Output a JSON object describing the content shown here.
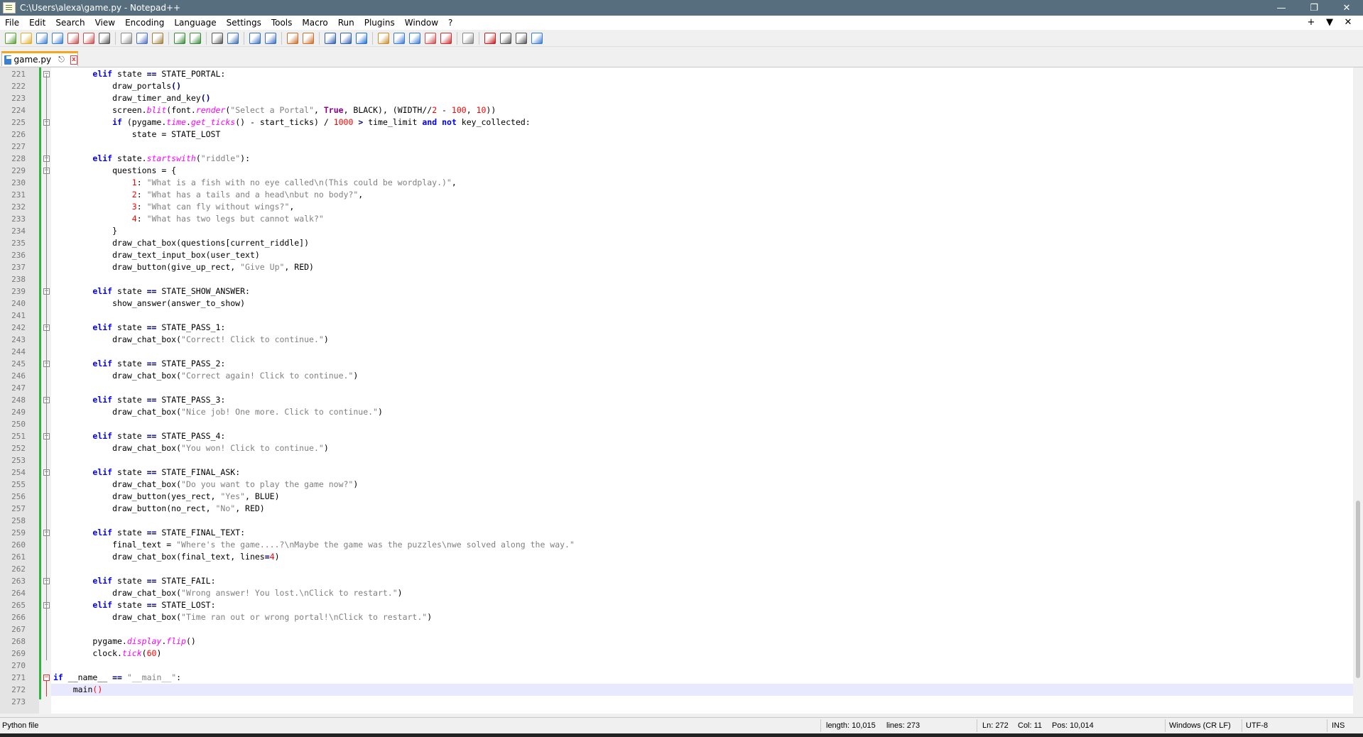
{
  "window": {
    "title": "C:\\Users\\alexa\\game.py - Notepad++",
    "controls": [
      "minimize-icon",
      "restore-icon",
      "close-icon"
    ]
  },
  "menu": {
    "items": [
      "File",
      "Edit",
      "Search",
      "View",
      "Encoding",
      "Language",
      "Settings",
      "Tools",
      "Macro",
      "Run",
      "Plugins",
      "Window",
      "?"
    ],
    "right": [
      "+",
      "▼",
      "✕"
    ]
  },
  "toolbar": {
    "buttons": [
      "new-file-icon",
      "open-file-icon",
      "save-icon",
      "save-all-icon",
      "close-icon",
      "close-all-icon",
      "print-icon",
      "cut-icon",
      "copy-icon",
      "paste-icon",
      "undo-icon",
      "redo-icon",
      "find-icon",
      "replace-icon",
      "zoom-in-icon",
      "zoom-out-icon",
      "sync-vertical-icon",
      "sync-horizontal-icon",
      "word-wrap-icon",
      "show-all-chars-icon",
      "indent-guide-icon",
      "user-language-icon",
      "doc-map-icon",
      "function-list-icon",
      "folder-workspace-icon",
      "monitoring-icon",
      "record-macro-icon",
      "stop-record-icon",
      "playback-macro-icon",
      "run-macro-multiple-icon",
      "save-macro-icon"
    ]
  },
  "tab": {
    "label": "game.py",
    "pin": "📌",
    "close": "x"
  },
  "editor": {
    "lines": [
      {
        "n": "221",
        "fold": "box",
        "tokens": [
          [
            "        ",
            ""
          ],
          [
            "elif",
            "kw"
          ],
          [
            " state ",
            ""
          ],
          [
            "==",
            "op"
          ],
          [
            " STATE_PORTAL:",
            ""
          ]
        ]
      },
      {
        "n": "222",
        "tokens": [
          [
            "            draw_portals",
            ""
          ],
          [
            "()",
            "op"
          ]
        ]
      },
      {
        "n": "223",
        "tokens": [
          [
            "            draw_timer_and_key",
            ""
          ],
          [
            "()",
            "op"
          ]
        ]
      },
      {
        "n": "224",
        "tokens": [
          [
            "            screen.",
            ""
          ],
          [
            "blit",
            "fn"
          ],
          [
            "(font.",
            ""
          ],
          [
            "render",
            "fn"
          ],
          [
            "(",
            ""
          ],
          [
            "\"Select a Portal\"",
            "str"
          ],
          [
            ", ",
            ""
          ],
          [
            "True",
            "bi"
          ],
          [
            ", BLACK), (WIDTH//",
            ""
          ],
          [
            "2",
            "num"
          ],
          [
            " - ",
            ""
          ],
          [
            "100",
            "num"
          ],
          [
            ", ",
            ""
          ],
          [
            "10",
            "num"
          ],
          [
            "))",
            ""
          ]
        ]
      },
      {
        "n": "225",
        "fold": "box",
        "tokens": [
          [
            "            ",
            ""
          ],
          [
            "if",
            "kw"
          ],
          [
            " (pygame.",
            ""
          ],
          [
            "time",
            "fn"
          ],
          [
            ".",
            ""
          ],
          [
            "get_ticks",
            "fn"
          ],
          [
            "() - start_ticks) / ",
            ""
          ],
          [
            "1000",
            "num"
          ],
          [
            " ",
            ""
          ],
          [
            ">",
            "op"
          ],
          [
            " time_limit ",
            ""
          ],
          [
            "and",
            "kw"
          ],
          [
            " ",
            ""
          ],
          [
            "not",
            "kw"
          ],
          [
            " key_collected:",
            ""
          ]
        ]
      },
      {
        "n": "226",
        "tokens": [
          [
            "                state = STATE_LOST",
            ""
          ]
        ]
      },
      {
        "n": "227",
        "tokens": []
      },
      {
        "n": "228",
        "fold": "box",
        "tokens": [
          [
            "        ",
            ""
          ],
          [
            "elif",
            "kw"
          ],
          [
            " state.",
            ""
          ],
          [
            "startswith",
            "fn"
          ],
          [
            "(",
            ""
          ],
          [
            "\"riddle\"",
            "str"
          ],
          [
            "):",
            ""
          ]
        ]
      },
      {
        "n": "229",
        "fold": "box",
        "tokens": [
          [
            "            questions = {",
            ""
          ]
        ]
      },
      {
        "n": "230",
        "tokens": [
          [
            "                ",
            ""
          ],
          [
            "1",
            "num"
          ],
          [
            ": ",
            ""
          ],
          [
            "\"What is a fish with no eye called\\n(This could be wordplay.)\"",
            "str"
          ],
          [
            ",",
            ""
          ]
        ]
      },
      {
        "n": "231",
        "tokens": [
          [
            "                ",
            ""
          ],
          [
            "2",
            "num"
          ],
          [
            ": ",
            ""
          ],
          [
            "\"What has a tails and a head\\nbut no body?\"",
            "str"
          ],
          [
            ",",
            ""
          ]
        ]
      },
      {
        "n": "232",
        "tokens": [
          [
            "                ",
            ""
          ],
          [
            "3",
            "num"
          ],
          [
            ": ",
            ""
          ],
          [
            "\"What can fly without wings?\"",
            "str"
          ],
          [
            ",",
            ""
          ]
        ]
      },
      {
        "n": "233",
        "tokens": [
          [
            "                ",
            ""
          ],
          [
            "4",
            "num"
          ],
          [
            ": ",
            ""
          ],
          [
            "\"What has two legs but cannot walk?\"",
            "str"
          ]
        ]
      },
      {
        "n": "234",
        "tokens": [
          [
            "            }",
            ""
          ]
        ]
      },
      {
        "n": "235",
        "tokens": [
          [
            "            draw_chat_box(questions[current_riddle])",
            ""
          ]
        ]
      },
      {
        "n": "236",
        "tokens": [
          [
            "            draw_text_input_box(user_text)",
            ""
          ]
        ]
      },
      {
        "n": "237",
        "tokens": [
          [
            "            draw_button(give_up_rect, ",
            ""
          ],
          [
            "\"Give Up\"",
            "str"
          ],
          [
            ", RED)",
            ""
          ]
        ]
      },
      {
        "n": "238",
        "tokens": []
      },
      {
        "n": "239",
        "fold": "box",
        "tokens": [
          [
            "        ",
            ""
          ],
          [
            "elif",
            "kw"
          ],
          [
            " state ",
            ""
          ],
          [
            "==",
            "op"
          ],
          [
            " STATE_SHOW_ANSWER:",
            ""
          ]
        ]
      },
      {
        "n": "240",
        "tokens": [
          [
            "            show_answer(answer_to_show)",
            ""
          ]
        ]
      },
      {
        "n": "241",
        "tokens": []
      },
      {
        "n": "242",
        "fold": "box",
        "tokens": [
          [
            "        ",
            ""
          ],
          [
            "elif",
            "kw"
          ],
          [
            " state ",
            ""
          ],
          [
            "==",
            "op"
          ],
          [
            " STATE_PASS_1:",
            ""
          ]
        ]
      },
      {
        "n": "243",
        "tokens": [
          [
            "            draw_chat_box(",
            ""
          ],
          [
            "\"Correct! Click to continue.\"",
            "str"
          ],
          [
            ")",
            ""
          ]
        ]
      },
      {
        "n": "244",
        "tokens": []
      },
      {
        "n": "245",
        "fold": "box",
        "tokens": [
          [
            "        ",
            ""
          ],
          [
            "elif",
            "kw"
          ],
          [
            " state ",
            ""
          ],
          [
            "==",
            "op"
          ],
          [
            " STATE_PASS_2:",
            ""
          ]
        ]
      },
      {
        "n": "246",
        "tokens": [
          [
            "            draw_chat_box(",
            ""
          ],
          [
            "\"Correct again! Click to continue.\"",
            "str"
          ],
          [
            ")",
            ""
          ]
        ]
      },
      {
        "n": "247",
        "tokens": []
      },
      {
        "n": "248",
        "fold": "box",
        "tokens": [
          [
            "        ",
            ""
          ],
          [
            "elif",
            "kw"
          ],
          [
            " state ",
            ""
          ],
          [
            "==",
            "op"
          ],
          [
            " STATE_PASS_3:",
            ""
          ]
        ]
      },
      {
        "n": "249",
        "tokens": [
          [
            "            draw_chat_box(",
            ""
          ],
          [
            "\"Nice job! One more. Click to continue.\"",
            "str"
          ],
          [
            ")",
            ""
          ]
        ]
      },
      {
        "n": "250",
        "tokens": []
      },
      {
        "n": "251",
        "fold": "box",
        "tokens": [
          [
            "        ",
            ""
          ],
          [
            "elif",
            "kw"
          ],
          [
            " state ",
            ""
          ],
          [
            "==",
            "op"
          ],
          [
            " STATE_PASS_4:",
            ""
          ]
        ]
      },
      {
        "n": "252",
        "tokens": [
          [
            "            draw_chat_box(",
            ""
          ],
          [
            "\"You won! Click to continue.\"",
            "str"
          ],
          [
            ")",
            ""
          ]
        ]
      },
      {
        "n": "253",
        "tokens": []
      },
      {
        "n": "254",
        "fold": "box",
        "tokens": [
          [
            "        ",
            ""
          ],
          [
            "elif",
            "kw"
          ],
          [
            " state ",
            ""
          ],
          [
            "==",
            "op"
          ],
          [
            " STATE_FINAL_ASK:",
            ""
          ]
        ]
      },
      {
        "n": "255",
        "tokens": [
          [
            "            draw_chat_box(",
            ""
          ],
          [
            "\"Do you want to play the game now?\"",
            "str"
          ],
          [
            ")",
            ""
          ]
        ]
      },
      {
        "n": "256",
        "tokens": [
          [
            "            draw_button(yes_rect, ",
            ""
          ],
          [
            "\"Yes\"",
            "str"
          ],
          [
            ", BLUE)",
            ""
          ]
        ]
      },
      {
        "n": "257",
        "tokens": [
          [
            "            draw_button(no_rect, ",
            ""
          ],
          [
            "\"No\"",
            "str"
          ],
          [
            ", RED)",
            ""
          ]
        ]
      },
      {
        "n": "258",
        "tokens": []
      },
      {
        "n": "259",
        "fold": "box",
        "tokens": [
          [
            "        ",
            ""
          ],
          [
            "elif",
            "kw"
          ],
          [
            " state ",
            ""
          ],
          [
            "==",
            "op"
          ],
          [
            " STATE_FINAL_TEXT:",
            ""
          ]
        ]
      },
      {
        "n": "260",
        "tokens": [
          [
            "            final_text = ",
            ""
          ],
          [
            "\"Where's the game....?\\nMaybe the game was the puzzles\\nwe solved along the way.\"",
            "str"
          ]
        ]
      },
      {
        "n": "261",
        "tokens": [
          [
            "            draw_chat_box(final_text, lines",
            ""
          ],
          [
            "=",
            "op"
          ],
          [
            "4",
            "num"
          ],
          [
            ")",
            ""
          ]
        ]
      },
      {
        "n": "262",
        "tokens": []
      },
      {
        "n": "263",
        "fold": "box",
        "tokens": [
          [
            "        ",
            ""
          ],
          [
            "elif",
            "kw"
          ],
          [
            " state ",
            ""
          ],
          [
            "==",
            "op"
          ],
          [
            " STATE_FAIL:",
            ""
          ]
        ]
      },
      {
        "n": "264",
        "tokens": [
          [
            "            draw_chat_box(",
            ""
          ],
          [
            "\"Wrong answer! You lost.\\nClick to restart.\"",
            "str"
          ],
          [
            ")",
            ""
          ]
        ]
      },
      {
        "n": "265",
        "fold": "box",
        "tokens": [
          [
            "        ",
            ""
          ],
          [
            "elif",
            "kw"
          ],
          [
            " state ",
            ""
          ],
          [
            "==",
            "op"
          ],
          [
            " STATE_LOST:",
            ""
          ]
        ]
      },
      {
        "n": "266",
        "tokens": [
          [
            "            draw_chat_box(",
            ""
          ],
          [
            "\"Time ran out or wrong portal!\\nClick to restart.\"",
            "str"
          ],
          [
            ")",
            ""
          ]
        ]
      },
      {
        "n": "267",
        "tokens": []
      },
      {
        "n": "268",
        "tokens": [
          [
            "        pygame.",
            ""
          ],
          [
            "display",
            "fn"
          ],
          [
            ".",
            ""
          ],
          [
            "flip",
            "fn"
          ],
          [
            "()",
            ""
          ]
        ]
      },
      {
        "n": "269",
        "tokens": [
          [
            "        clock.",
            ""
          ],
          [
            "tick",
            "fn"
          ],
          [
            "(",
            ""
          ],
          [
            "60",
            "num"
          ],
          [
            ")",
            ""
          ]
        ]
      },
      {
        "n": "270",
        "tokens": []
      },
      {
        "n": "271",
        "fold": "red",
        "tokens": [
          [
            "",
            ""
          ],
          [
            "if",
            "kw"
          ],
          [
            " __name__ ",
            ""
          ],
          [
            "==",
            "op"
          ],
          [
            " ",
            ""
          ],
          [
            "\"__main__\"",
            "str"
          ],
          [
            ":",
            ""
          ]
        ]
      },
      {
        "n": "272",
        "current": true,
        "tokens": [
          [
            "    main",
            ""
          ],
          [
            "()",
            "num"
          ]
        ]
      },
      {
        "n": "273",
        "tokens": []
      }
    ]
  },
  "status": {
    "filetype": "Python file",
    "length": "length: 10,015",
    "lines": "lines: 273",
    "ln": "Ln: 272",
    "col": "Col: 11",
    "pos": "Pos: 10,014",
    "eol": "Windows (CR LF)",
    "encoding": "UTF-8",
    "mode": "INS"
  },
  "colors": {
    "titlebar": "#576e7f",
    "keyword": "#0000ff",
    "string": "#808080",
    "number": "#ff0000",
    "function": "#ff00ff",
    "changebar": "#2fb43d",
    "tab_accent": "#f7a51d"
  }
}
